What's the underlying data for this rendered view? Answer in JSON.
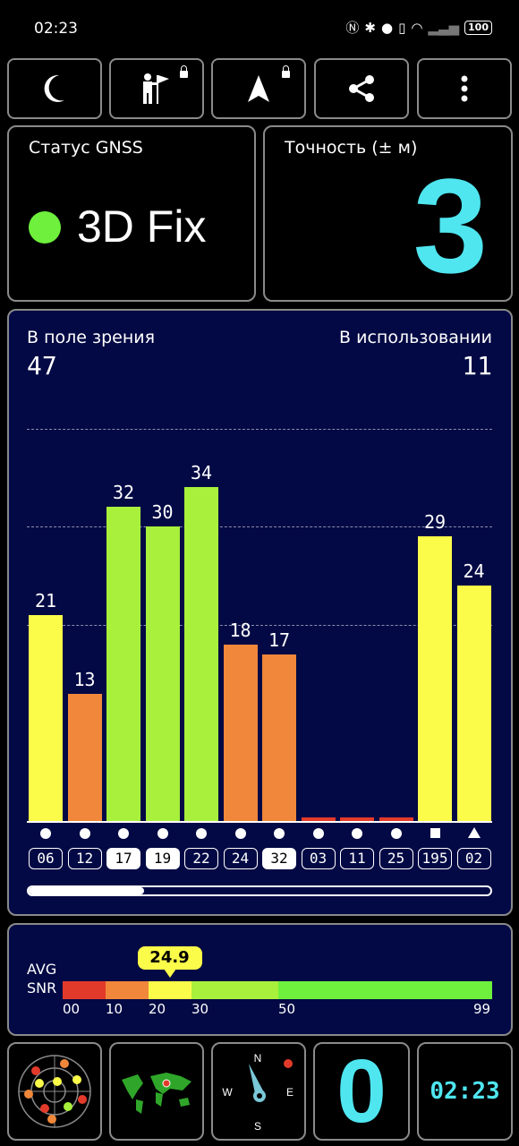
{
  "status_bar": {
    "time": "02:23",
    "icons": [
      "nfc-icon",
      "bluetooth-icon",
      "location-icon",
      "vibrate-icon",
      "wifi-icon",
      "signal-icon"
    ],
    "battery": "100"
  },
  "toolbar": {
    "buttons": [
      "night-mode-icon",
      "person-flag-icon",
      "navigation-arrow-icon",
      "share-icon",
      "more-vert-icon"
    ]
  },
  "gnss_status": {
    "label": "Статус GNSS",
    "value": "3D Fix",
    "color": "#6ef03c"
  },
  "accuracy": {
    "label": "Точность (± м)",
    "value": "3",
    "color": "#4fe6f0"
  },
  "satellites": {
    "in_view_label": "В поле зрения",
    "in_view_value": "47",
    "in_use_label": "В использовании",
    "in_use_value": "11",
    "scroll_progress": 0.25
  },
  "chart_data": {
    "type": "bar",
    "categories": [
      "06",
      "12",
      "17",
      "19",
      "22",
      "24",
      "32",
      "03",
      "11",
      "25",
      "195",
      "02"
    ],
    "values": [
      21,
      13,
      32,
      30,
      34,
      18,
      17,
      0,
      0,
      0,
      29,
      24
    ],
    "shown_labels": [
      "21",
      "13",
      "32",
      "30",
      "34",
      "18",
      "17",
      "",
      "",
      "",
      "29",
      "24"
    ],
    "used": [
      false,
      false,
      true,
      true,
      false,
      false,
      true,
      false,
      false,
      false,
      false,
      false
    ],
    "markers": [
      "circle",
      "circle",
      "circle",
      "circle",
      "circle",
      "circle",
      "circle",
      "circle",
      "circle",
      "circle",
      "square",
      "triangle"
    ],
    "ylim": [
      0,
      50
    ],
    "gridlines": [
      20,
      30,
      40
    ],
    "colors": {
      "low": "#e23a2a",
      "mid": "#f0873a",
      "high": "#fbfb4a",
      "good": "#a8f03c"
    }
  },
  "snr": {
    "label_line1": "AVG",
    "label_line2": "SNR",
    "avg": "24.9",
    "avg_value": 24.9,
    "ticks": [
      "00",
      "10",
      "20",
      "30",
      "50",
      "99"
    ]
  },
  "bottom_bar": {
    "items": [
      "sky-plot-icon",
      "world-map-icon",
      "compass-icon"
    ],
    "compass_letters": [
      "N",
      "E",
      "S",
      "W"
    ],
    "speed": "0",
    "clock": "02:23",
    "speed_color": "#4fe6f0"
  }
}
